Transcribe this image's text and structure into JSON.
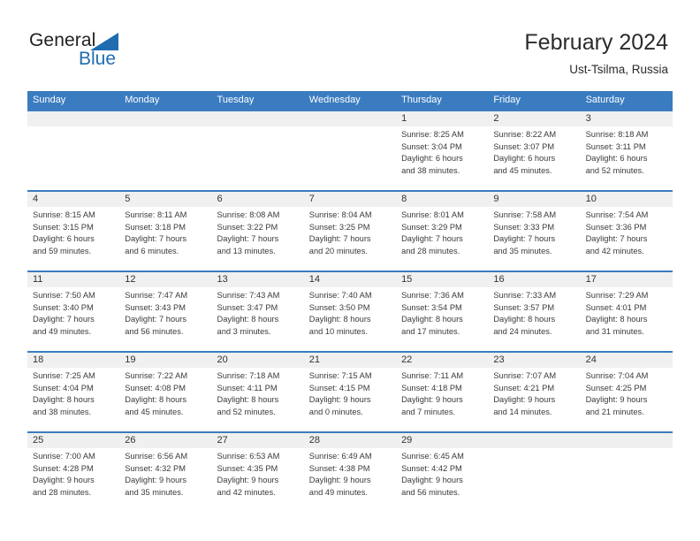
{
  "brand": {
    "name_part1": "General",
    "name_part2": "Blue",
    "logo_icon": "triangle-icon"
  },
  "header": {
    "title": "February 2024",
    "subtitle": "Ust-Tsilma, Russia"
  },
  "colors": {
    "header_blue": "#3b7cc0",
    "daynum_band": "#f0f0f0",
    "logo_blue": "#1f6cb0",
    "text": "#3a3a3a"
  },
  "weekdays": [
    "Sunday",
    "Monday",
    "Tuesday",
    "Wednesday",
    "Thursday",
    "Friday",
    "Saturday"
  ],
  "weeks": [
    [
      {
        "day": "",
        "sunrise": "",
        "sunset": "",
        "daylight_1": "",
        "daylight_2": ""
      },
      {
        "day": "",
        "sunrise": "",
        "sunset": "",
        "daylight_1": "",
        "daylight_2": ""
      },
      {
        "day": "",
        "sunrise": "",
        "sunset": "",
        "daylight_1": "",
        "daylight_2": ""
      },
      {
        "day": "",
        "sunrise": "",
        "sunset": "",
        "daylight_1": "",
        "daylight_2": ""
      },
      {
        "day": "1",
        "sunrise": "Sunrise: 8:25 AM",
        "sunset": "Sunset: 3:04 PM",
        "daylight_1": "Daylight: 6 hours",
        "daylight_2": "and 38 minutes."
      },
      {
        "day": "2",
        "sunrise": "Sunrise: 8:22 AM",
        "sunset": "Sunset: 3:07 PM",
        "daylight_1": "Daylight: 6 hours",
        "daylight_2": "and 45 minutes."
      },
      {
        "day": "3",
        "sunrise": "Sunrise: 8:18 AM",
        "sunset": "Sunset: 3:11 PM",
        "daylight_1": "Daylight: 6 hours",
        "daylight_2": "and 52 minutes."
      }
    ],
    [
      {
        "day": "4",
        "sunrise": "Sunrise: 8:15 AM",
        "sunset": "Sunset: 3:15 PM",
        "daylight_1": "Daylight: 6 hours",
        "daylight_2": "and 59 minutes."
      },
      {
        "day": "5",
        "sunrise": "Sunrise: 8:11 AM",
        "sunset": "Sunset: 3:18 PM",
        "daylight_1": "Daylight: 7 hours",
        "daylight_2": "and 6 minutes."
      },
      {
        "day": "6",
        "sunrise": "Sunrise: 8:08 AM",
        "sunset": "Sunset: 3:22 PM",
        "daylight_1": "Daylight: 7 hours",
        "daylight_2": "and 13 minutes."
      },
      {
        "day": "7",
        "sunrise": "Sunrise: 8:04 AM",
        "sunset": "Sunset: 3:25 PM",
        "daylight_1": "Daylight: 7 hours",
        "daylight_2": "and 20 minutes."
      },
      {
        "day": "8",
        "sunrise": "Sunrise: 8:01 AM",
        "sunset": "Sunset: 3:29 PM",
        "daylight_1": "Daylight: 7 hours",
        "daylight_2": "and 28 minutes."
      },
      {
        "day": "9",
        "sunrise": "Sunrise: 7:58 AM",
        "sunset": "Sunset: 3:33 PM",
        "daylight_1": "Daylight: 7 hours",
        "daylight_2": "and 35 minutes."
      },
      {
        "day": "10",
        "sunrise": "Sunrise: 7:54 AM",
        "sunset": "Sunset: 3:36 PM",
        "daylight_1": "Daylight: 7 hours",
        "daylight_2": "and 42 minutes."
      }
    ],
    [
      {
        "day": "11",
        "sunrise": "Sunrise: 7:50 AM",
        "sunset": "Sunset: 3:40 PM",
        "daylight_1": "Daylight: 7 hours",
        "daylight_2": "and 49 minutes."
      },
      {
        "day": "12",
        "sunrise": "Sunrise: 7:47 AM",
        "sunset": "Sunset: 3:43 PM",
        "daylight_1": "Daylight: 7 hours",
        "daylight_2": "and 56 minutes."
      },
      {
        "day": "13",
        "sunrise": "Sunrise: 7:43 AM",
        "sunset": "Sunset: 3:47 PM",
        "daylight_1": "Daylight: 8 hours",
        "daylight_2": "and 3 minutes."
      },
      {
        "day": "14",
        "sunrise": "Sunrise: 7:40 AM",
        "sunset": "Sunset: 3:50 PM",
        "daylight_1": "Daylight: 8 hours",
        "daylight_2": "and 10 minutes."
      },
      {
        "day": "15",
        "sunrise": "Sunrise: 7:36 AM",
        "sunset": "Sunset: 3:54 PM",
        "daylight_1": "Daylight: 8 hours",
        "daylight_2": "and 17 minutes."
      },
      {
        "day": "16",
        "sunrise": "Sunrise: 7:33 AM",
        "sunset": "Sunset: 3:57 PM",
        "daylight_1": "Daylight: 8 hours",
        "daylight_2": "and 24 minutes."
      },
      {
        "day": "17",
        "sunrise": "Sunrise: 7:29 AM",
        "sunset": "Sunset: 4:01 PM",
        "daylight_1": "Daylight: 8 hours",
        "daylight_2": "and 31 minutes."
      }
    ],
    [
      {
        "day": "18",
        "sunrise": "Sunrise: 7:25 AM",
        "sunset": "Sunset: 4:04 PM",
        "daylight_1": "Daylight: 8 hours",
        "daylight_2": "and 38 minutes."
      },
      {
        "day": "19",
        "sunrise": "Sunrise: 7:22 AM",
        "sunset": "Sunset: 4:08 PM",
        "daylight_1": "Daylight: 8 hours",
        "daylight_2": "and 45 minutes."
      },
      {
        "day": "20",
        "sunrise": "Sunrise: 7:18 AM",
        "sunset": "Sunset: 4:11 PM",
        "daylight_1": "Daylight: 8 hours",
        "daylight_2": "and 52 minutes."
      },
      {
        "day": "21",
        "sunrise": "Sunrise: 7:15 AM",
        "sunset": "Sunset: 4:15 PM",
        "daylight_1": "Daylight: 9 hours",
        "daylight_2": "and 0 minutes."
      },
      {
        "day": "22",
        "sunrise": "Sunrise: 7:11 AM",
        "sunset": "Sunset: 4:18 PM",
        "daylight_1": "Daylight: 9 hours",
        "daylight_2": "and 7 minutes."
      },
      {
        "day": "23",
        "sunrise": "Sunrise: 7:07 AM",
        "sunset": "Sunset: 4:21 PM",
        "daylight_1": "Daylight: 9 hours",
        "daylight_2": "and 14 minutes."
      },
      {
        "day": "24",
        "sunrise": "Sunrise: 7:04 AM",
        "sunset": "Sunset: 4:25 PM",
        "daylight_1": "Daylight: 9 hours",
        "daylight_2": "and 21 minutes."
      }
    ],
    [
      {
        "day": "25",
        "sunrise": "Sunrise: 7:00 AM",
        "sunset": "Sunset: 4:28 PM",
        "daylight_1": "Daylight: 9 hours",
        "daylight_2": "and 28 minutes."
      },
      {
        "day": "26",
        "sunrise": "Sunrise: 6:56 AM",
        "sunset": "Sunset: 4:32 PM",
        "daylight_1": "Daylight: 9 hours",
        "daylight_2": "and 35 minutes."
      },
      {
        "day": "27",
        "sunrise": "Sunrise: 6:53 AM",
        "sunset": "Sunset: 4:35 PM",
        "daylight_1": "Daylight: 9 hours",
        "daylight_2": "and 42 minutes."
      },
      {
        "day": "28",
        "sunrise": "Sunrise: 6:49 AM",
        "sunset": "Sunset: 4:38 PM",
        "daylight_1": "Daylight: 9 hours",
        "daylight_2": "and 49 minutes."
      },
      {
        "day": "29",
        "sunrise": "Sunrise: 6:45 AM",
        "sunset": "Sunset: 4:42 PM",
        "daylight_1": "Daylight: 9 hours",
        "daylight_2": "and 56 minutes."
      },
      {
        "day": "",
        "sunrise": "",
        "sunset": "",
        "daylight_1": "",
        "daylight_2": ""
      },
      {
        "day": "",
        "sunrise": "",
        "sunset": "",
        "daylight_1": "",
        "daylight_2": ""
      }
    ]
  ]
}
